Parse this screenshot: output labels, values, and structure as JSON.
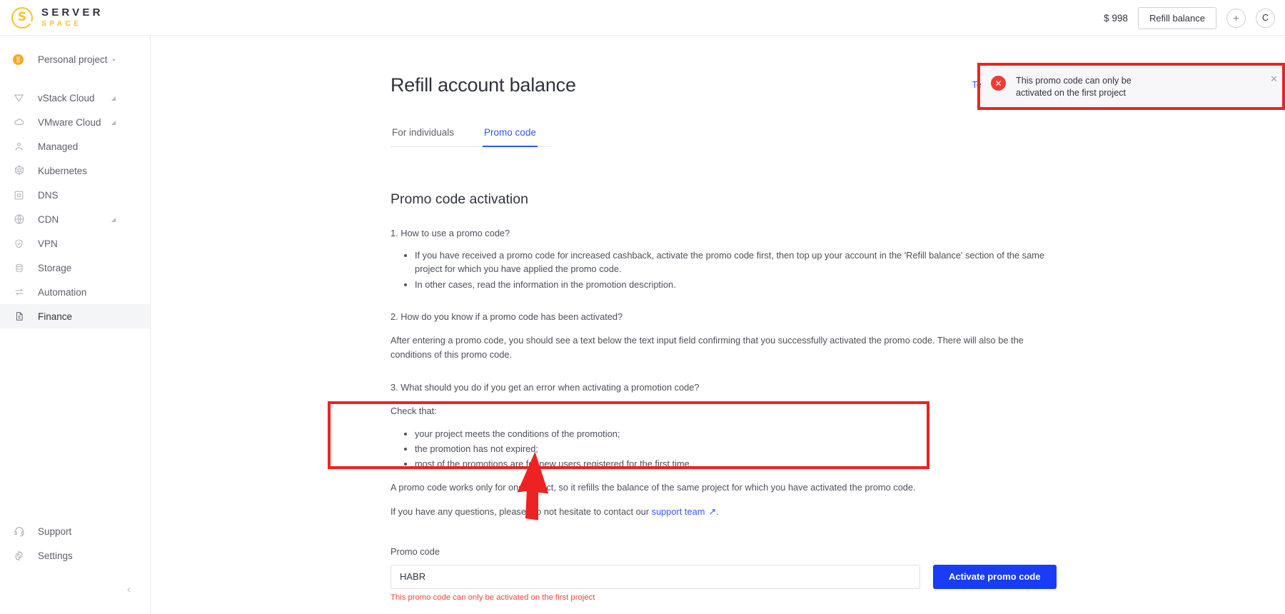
{
  "brand": {
    "logo_top": "SERVER",
    "logo_bottom": "SPACE",
    "logo_glyph": "S",
    "accent_yellow": "#fbc02d",
    "accent_blue": "#3355ff",
    "error_red": "#ee2222"
  },
  "topbar": {
    "balance": "$ 998",
    "refill_label": "Refill balance",
    "add_label": "+",
    "avatar_label": "C"
  },
  "sidebar": {
    "project": {
      "label": "Personal project",
      "caret": "▸"
    },
    "items": [
      {
        "label": "vStack Cloud",
        "icon": "vstack-icon",
        "caret": "◢"
      },
      {
        "label": "VMware Cloud",
        "icon": "cloud-icon",
        "caret": "◢"
      },
      {
        "label": "Managed",
        "icon": "managed-icon",
        "caret": ""
      },
      {
        "label": "Kubernetes",
        "icon": "kubernetes-icon",
        "caret": ""
      },
      {
        "label": "DNS",
        "icon": "dns-icon",
        "caret": ""
      },
      {
        "label": "CDN",
        "icon": "cdn-icon",
        "caret": "◢"
      },
      {
        "label": "VPN",
        "icon": "vpn-icon",
        "caret": ""
      },
      {
        "label": "Storage",
        "icon": "storage-icon",
        "caret": ""
      },
      {
        "label": "Automation",
        "icon": "automation-icon",
        "caret": ""
      },
      {
        "label": "Finance",
        "icon": "finance-icon",
        "caret": "",
        "active": true
      }
    ],
    "bottom_items": [
      {
        "label": "Support",
        "icon": "headset-icon"
      },
      {
        "label": "Settings",
        "icon": "gear-icon"
      }
    ],
    "collapse_glyph": "‹"
  },
  "page": {
    "title": "Refill account balance",
    "terms_link": "Terms of payment",
    "terms_arrow": "↗",
    "tabs": [
      {
        "label": "For individuals",
        "active": false
      },
      {
        "label": "Promo code",
        "active": true
      }
    ],
    "section_title": "Promo code activation",
    "q1": "1. How to use a promo code?",
    "q1_bullets": [
      "If you have received a promo code for increased cashback, activate the promo code first, then top up your account in the 'Refill balance' section of the same project for which you have applied the promo code.",
      "In other cases, read the information in the promotion description."
    ],
    "q2": "2. How do you know if a promo code has been activated?",
    "q2_answer": "After entering a promo code, you should see a text below the text input field confirming that you successfully activated the promo code. There will also be the conditions of this promo code.",
    "q3": "3. What should you do if you get an error when activating a promotion code?",
    "check_that": "Check that:",
    "check_bullets": [
      "your project meets the conditions of the promotion;",
      "the promotion has not expired;",
      "most of the promotions are for new users registered for the first time."
    ],
    "note": "A promo code works only for one project, so it refills the balance of the same project for which you have activated the promo code.",
    "contact_prefix": "If you have any questions, please, do not hesitate to contact our ",
    "contact_link": "support team",
    "contact_arrow": "↗",
    "contact_suffix": "."
  },
  "form": {
    "label": "Promo code",
    "value": "HABR",
    "placeholder": "Promo code",
    "error": "This promo code can only be activated on the first project",
    "submit_label": "Activate promo code"
  },
  "toast": {
    "message": "This promo code can only be activated on the first project",
    "icon_glyph": "✕",
    "close_glyph": "✕"
  }
}
